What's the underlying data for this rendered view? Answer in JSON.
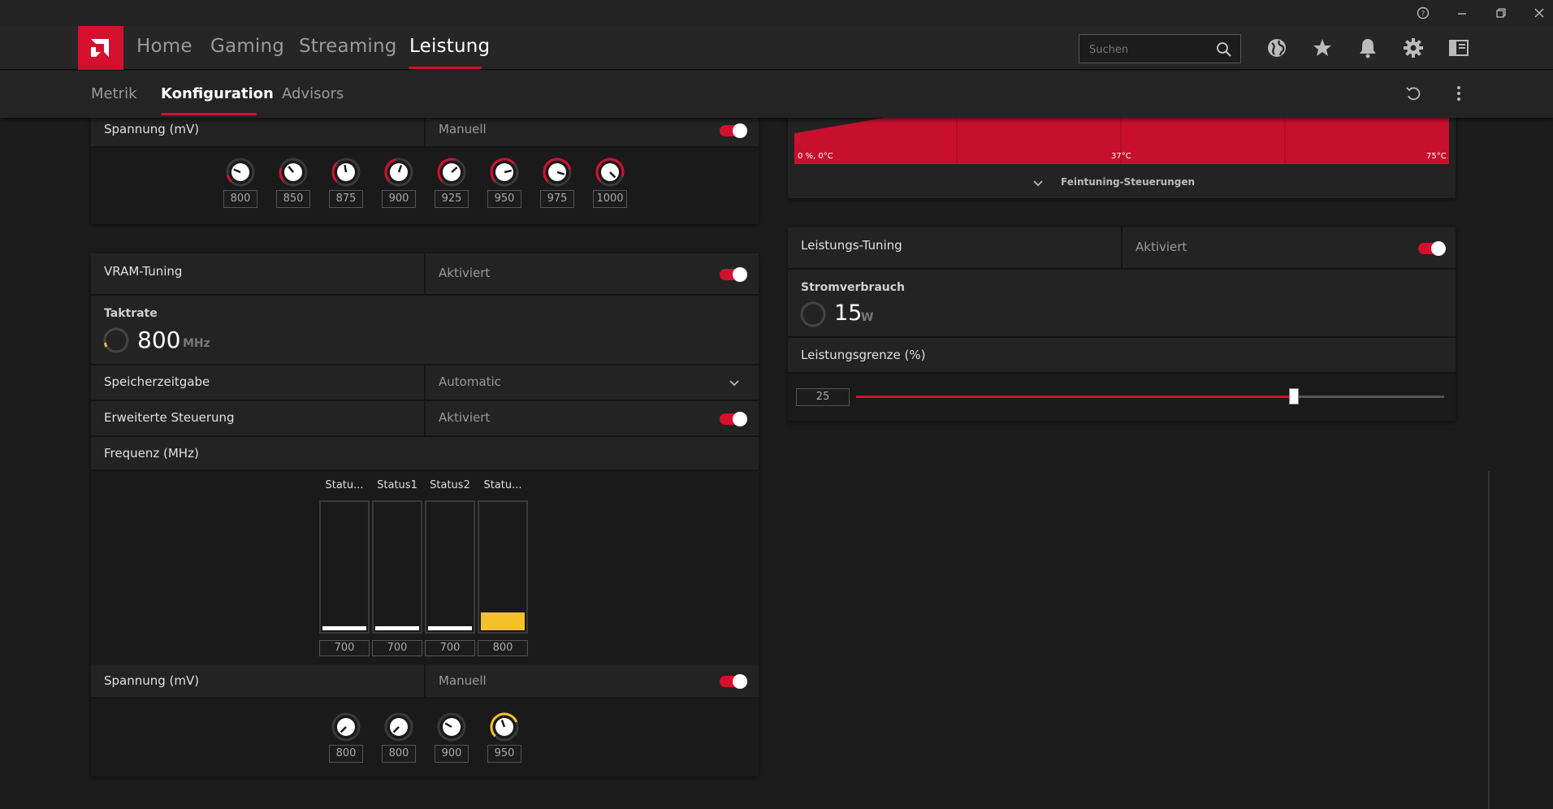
{
  "nav": {
    "tabs": [
      "Home",
      "Gaming",
      "Streaming",
      "Leistung"
    ],
    "active": "Leistung",
    "search_placeholder": "Suchen"
  },
  "subnav": {
    "tabs": [
      "Metrik",
      "Konfiguration",
      "Advisors"
    ],
    "active": "Konfiguration"
  },
  "gpu_voltage": {
    "label": "Spannung (mV)",
    "mode": "Manuell",
    "enabled": true,
    "values": [
      "800",
      "850",
      "875",
      "900",
      "925",
      "950",
      "975",
      "1000"
    ]
  },
  "vram": {
    "title": "VRAM-Tuning",
    "status": "Aktiviert",
    "clock_label": "Taktrate",
    "clock_value": "800",
    "clock_unit": "MHz",
    "timing_label": "Speicherzeitgabe",
    "timing_value": "Automatic",
    "advanced_label": "Erweiterte Steuerung",
    "advanced_status": "Aktiviert",
    "freq_label": "Frequenz (MHz)",
    "states": [
      {
        "label": "Statu...",
        "value": "700",
        "fill": 0.03,
        "color": "#ffffff"
      },
      {
        "label": "Status1",
        "value": "700",
        "fill": 0.03,
        "color": "#ffffff"
      },
      {
        "label": "Status2",
        "value": "700",
        "fill": 0.03,
        "color": "#ffffff"
      },
      {
        "label": "Statu...",
        "value": "800",
        "fill": 0.14,
        "color": "#f5c12a"
      }
    ],
    "voltage_label": "Spannung (mV)",
    "voltage_mode": "Manuell",
    "voltage_values": [
      "800",
      "800",
      "900",
      "950"
    ]
  },
  "fan_curve": {
    "x_start": "0 %, 0°C",
    "x_mid": "37°C",
    "x_end": "75°C",
    "finetune_label": "Feintuning-Steuerungen",
    "fill_color": "#c8102e"
  },
  "power": {
    "title": "Leistungs-Tuning",
    "status": "Aktiviert",
    "consumption_label": "Stromverbrauch",
    "consumption_value": "15",
    "consumption_unit": "W",
    "limit_label": "Leistungsgrenze (%)",
    "limit_value": "25",
    "limit_fraction": 0.745
  },
  "colors": {
    "accent": "#d5102e",
    "yellow": "#f5c12a"
  }
}
